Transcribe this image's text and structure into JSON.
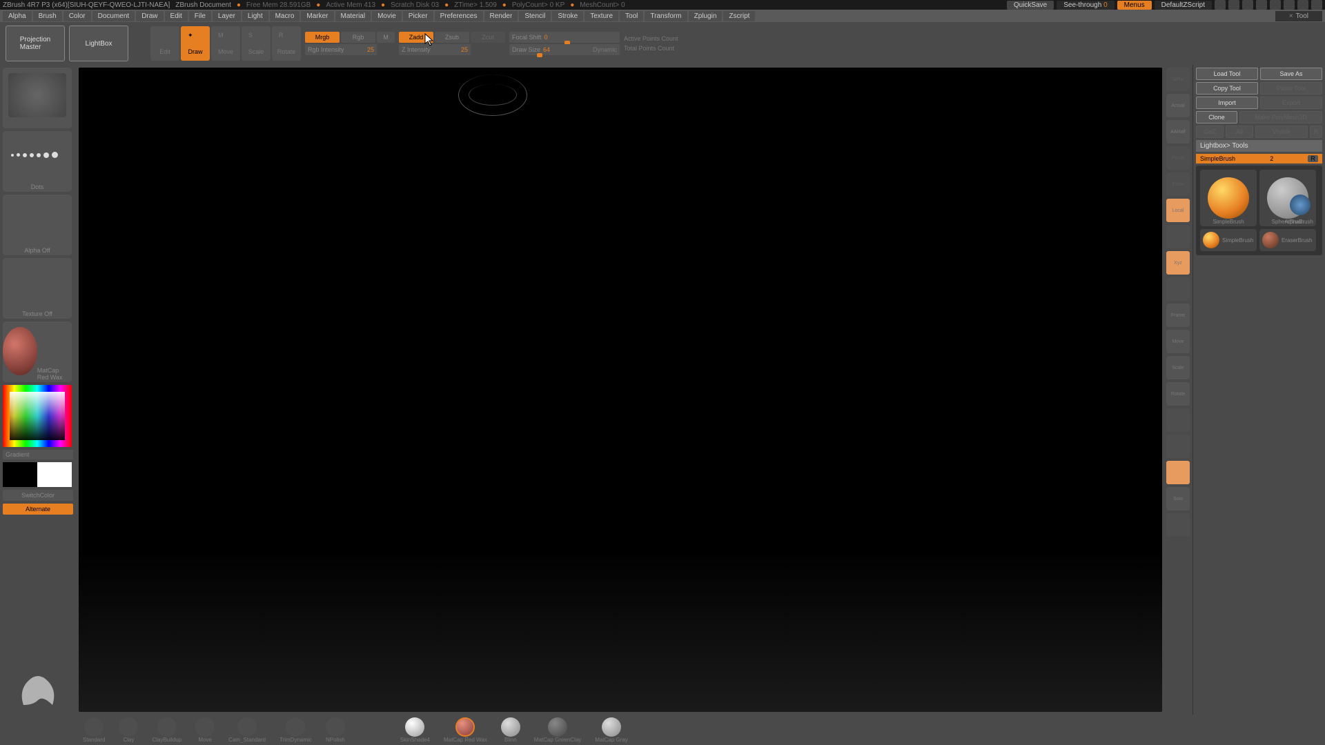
{
  "title": {
    "app": "ZBrush 4R7 P3 (x64)[SIUH-QEYF-QWEO-LJTI-NAEA]",
    "doc": "ZBrush Document",
    "stats": [
      "Free Mem 28.591GB",
      "Active Mem 413",
      "Scratch Disk 03",
      "ZTime> 1.509",
      "PolyCount> 0 KP",
      "MeshCount> 0"
    ],
    "quicksave": "QuickSave",
    "seethrough": "See-through",
    "seethrough_val": "0",
    "menus": "Menus",
    "script": "DefaultZScript"
  },
  "menu": [
    "Alpha",
    "Brush",
    "Color",
    "Document",
    "Draw",
    "Edit",
    "File",
    "Layer",
    "Light",
    "Macro",
    "Marker",
    "Material",
    "Movie",
    "Picker",
    "Preferences",
    "Render",
    "Stencil",
    "Stroke",
    "Texture",
    "Tool",
    "Transform",
    "Zplugin",
    "Zscript"
  ],
  "tool_header": "Tool",
  "shelf": {
    "projection": "Projection\nMaster",
    "lightbox": "LightBox",
    "modes": [
      "Edit",
      "Draw",
      "Move",
      "Scale",
      "Rotate"
    ],
    "mrgb": "Mrgb",
    "rgb": "Rgb",
    "m": "M",
    "rgb_intensity": "Rgb Intensity",
    "rgb_intensity_val": "25",
    "zadd": "Zadd",
    "zsub": "Zsub",
    "zcut": "Zcut",
    "z_intensity": "Z Intensity",
    "z_intensity_val": "25",
    "focal": "Focal Shift",
    "focal_val": "0",
    "draw_size": "Draw Size",
    "draw_size_val": "64",
    "dynamic": "Dynamic",
    "active_points": "Active Points Count",
    "total_points": "Total Points Count"
  },
  "left": {
    "brush": "",
    "stroke": "Dots",
    "alpha": "Alpha Off",
    "texture": "Texture Off",
    "material": "MatCap Red Wax",
    "gradient": "Gradient",
    "switch": "SwitchColor",
    "alternate": "Alternate"
  },
  "right_toolbar": [
    "SPix",
    "Actual",
    "AAHalf",
    "Persp",
    "Floor",
    "Local",
    "Xyz",
    "",
    "",
    "Frame",
    "Move",
    "Scale",
    "Rotate",
    "",
    "Solo",
    "",
    ""
  ],
  "right_panel": {
    "load": "Load Tool",
    "save": "Save As",
    "copy": "Copy Tool",
    "paste": "Paste Tool",
    "import": "Import",
    "export": "Export",
    "clone": "Clone",
    "make": "Make PolyMesh3D",
    "gz": "GoZ",
    "all": "All",
    "visible": "Visible",
    "r": "R",
    "lightbox": "Lightbox> Tools",
    "simple": "SimpleBrush",
    "simple_n": "2",
    "tools": [
      "SimpleBrush",
      "SphereBrush",
      "AlphaBrush",
      "SimpleBrush",
      "EraserBrush"
    ]
  },
  "bottom": [
    "Standard",
    "Clay",
    "ClayBuildup",
    "Move",
    "Cam_Standard",
    "TrimDynamic",
    "NPolish",
    "SkinShade4",
    "MatCap Red Wax",
    "Blinn",
    "MatCap GreenClay",
    "MatCap Gray"
  ]
}
